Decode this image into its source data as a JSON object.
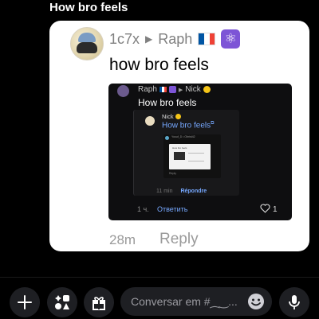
{
  "page": {
    "title": "How bro feels"
  },
  "message": {
    "author": "1c7x",
    "replied_to": "Raph",
    "text": "how bro feels",
    "time": "28m",
    "reply_label": "Reply",
    "flag_colors": [
      "#0055a4",
      "#ffffff",
      "#ef4135"
    ],
    "badge_icon": "atom-icon"
  },
  "embedded_1": {
    "author": "Raph",
    "replied_to": "Nick",
    "text": "How bro feels",
    "time": "1 ч.",
    "reply_label": "Ответить",
    "reaction_count": "1"
  },
  "embedded_2": {
    "author": "Nick",
    "text": "How bro feels",
    "time": "11 min",
    "reply_label": "Répondre"
  },
  "embedded_3": {
    "header": "Yusuf_D • Obrist42",
    "image_header": "How bro feels",
    "footer": "Reply"
  },
  "composer": {
    "placeholder": "Conversar em #⁔‿..."
  },
  "icons": [
    "plus-icon",
    "apps-icon",
    "gift-icon",
    "emoji-icon",
    "microphone-icon"
  ]
}
